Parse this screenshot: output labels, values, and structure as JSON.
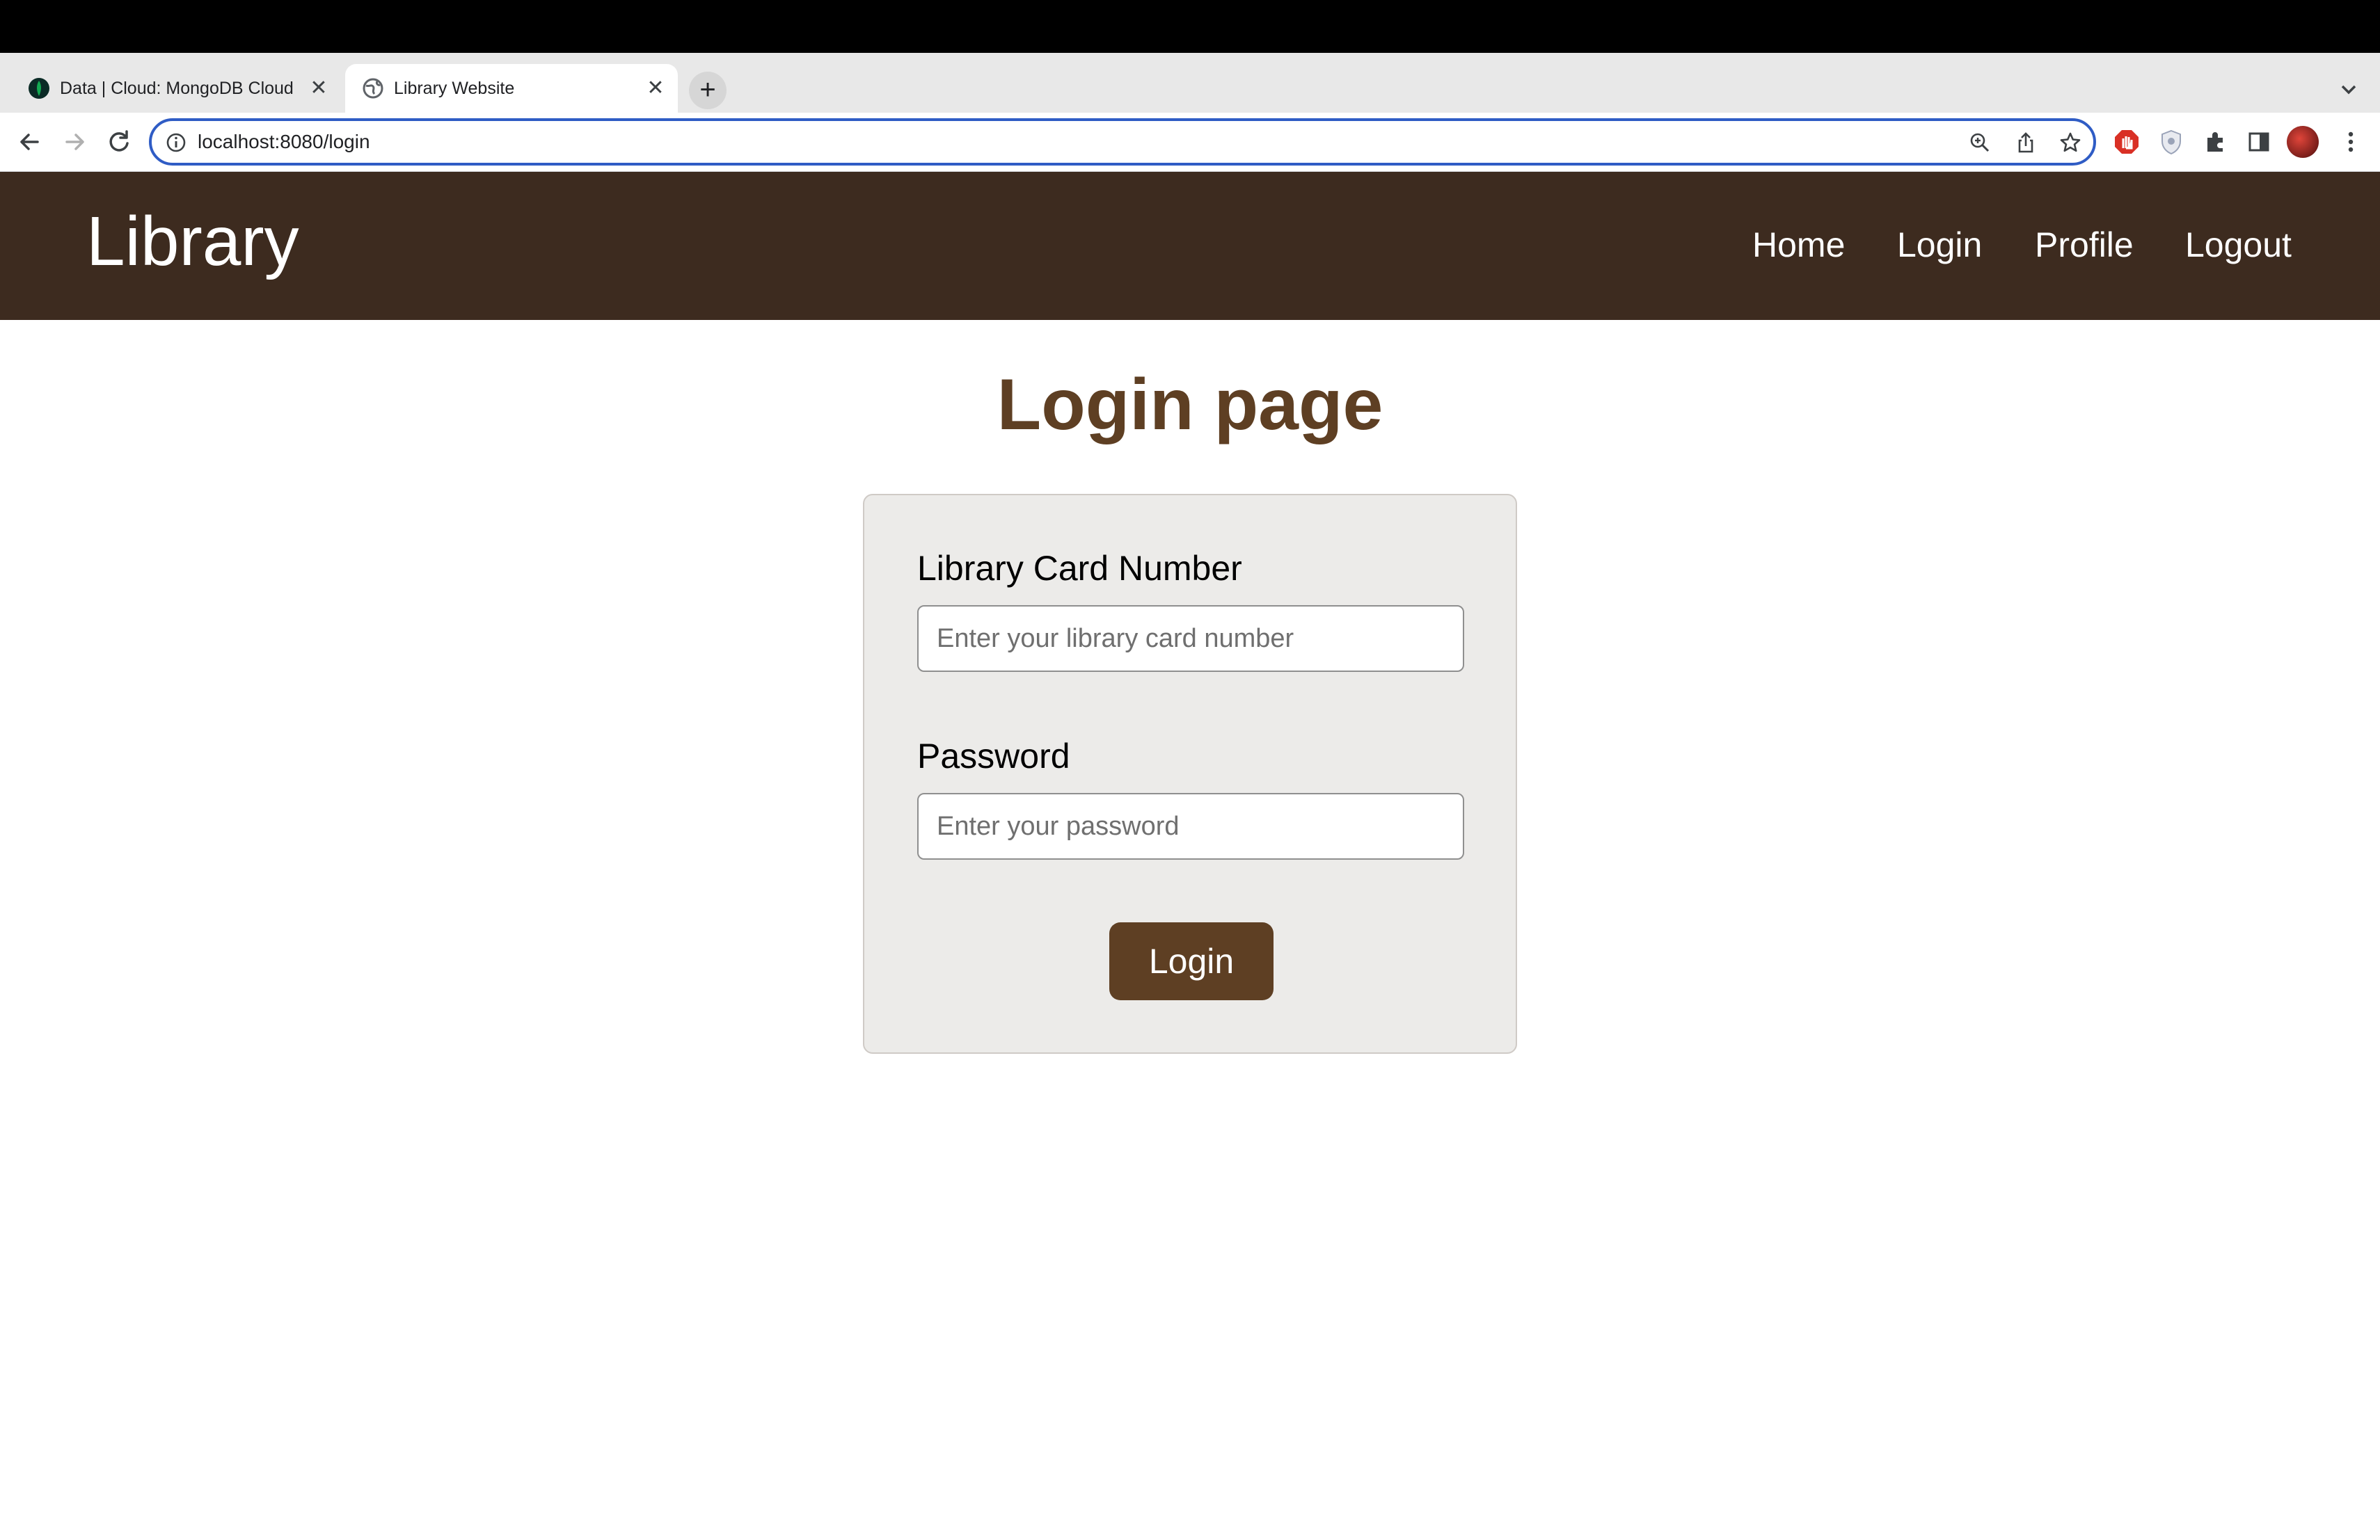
{
  "browser": {
    "tabs": [
      {
        "title": "Data | Cloud: MongoDB Cloud",
        "active": false,
        "favicon": "mongodb-leaf-icon"
      },
      {
        "title": "Library Website",
        "active": true,
        "favicon": "globe-icon"
      }
    ],
    "close_glyph": "✕",
    "new_tab_glyph": "+",
    "url": "localhost:8080/login"
  },
  "site": {
    "brand": "Library",
    "nav": {
      "home": "Home",
      "login": "Login",
      "profile": "Profile",
      "logout": "Logout"
    }
  },
  "page": {
    "title": "Login page"
  },
  "form": {
    "card_label": "Library Card Number",
    "card_placeholder": "Enter your library card number",
    "password_label": "Password",
    "password_placeholder": "Enter your password",
    "submit_label": "Login"
  },
  "colors": {
    "header_bg": "#3d2b1f",
    "accent": "#5e3f23",
    "card_bg": "#ecebe9",
    "omnibox_focus": "#2f5cc5"
  }
}
